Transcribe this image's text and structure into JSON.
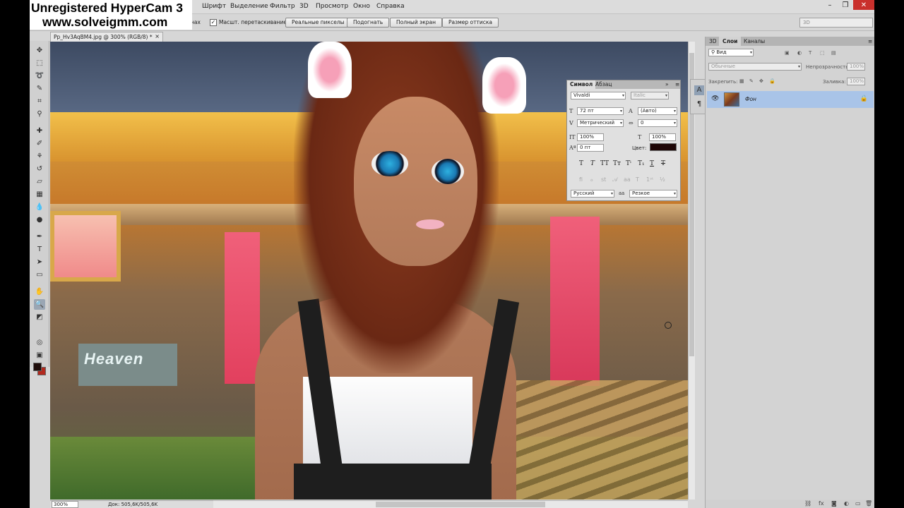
{
  "watermark": {
    "line1": "Unregistered HyperCam 3",
    "line2": "www.solveigmm.com"
  },
  "menu": {
    "items": [
      "Шрифт",
      "Выделение",
      "Фильтр",
      "3D",
      "Просмотр",
      "Окно",
      "Справка"
    ]
  },
  "options_bar": {
    "cut_text": "нах",
    "checkbox_label": "Масшт. перетаскиванием",
    "checkbox_checked": true,
    "buttons": [
      "Реальные пикселы",
      "Подогнать",
      "Полный экран",
      "Размер оттиска"
    ],
    "workspace": "3D"
  },
  "document": {
    "tab_title": "Pp_Hv3AqBM4.jpg @ 300% (RGB/8) *",
    "zoom": "300%",
    "doc_info": "Док: 505,6K/505,6K",
    "sign_text": "Heaven"
  },
  "character_panel": {
    "tab_character": "Символ",
    "tab_paragraph": "Абзац",
    "font_family": "Vivaldi",
    "font_style": "Italic",
    "font_size": "72 пт",
    "leading": "(Авто)",
    "kerning": "Метрический",
    "tracking": "0",
    "vertical_scale": "100%",
    "horizontal_scale": "100%",
    "baseline_shift": "0 пт",
    "color_label": "Цвет:",
    "color": "#1e0606",
    "language": "Русский",
    "antialias_label": "aa",
    "antialias": "Резкое"
  },
  "layers_panel": {
    "tabs": [
      "3D",
      "Слои",
      "Каналы"
    ],
    "active_tab": "Слои",
    "kind_filter": "Вид",
    "blend_mode": "Обычные",
    "opacity_label": "Непрозрачность:",
    "opacity": "100%",
    "lock_label": "Закрепить:",
    "fill_label": "Заливка:",
    "fill": "100%",
    "layer_name": "Фон"
  },
  "colors": {
    "foreground": "#1e0c0a",
    "background": "#b2291e",
    "selection": "#a9c4e8"
  }
}
